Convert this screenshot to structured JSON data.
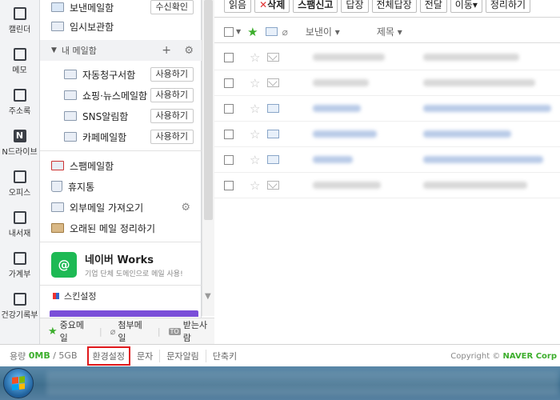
{
  "rail": {
    "items": [
      {
        "label": "캘린더",
        "icon": "calendar-icon"
      },
      {
        "label": "메모",
        "icon": "memo-icon"
      },
      {
        "label": "주소록",
        "icon": "contacts-icon"
      },
      {
        "label": "N드라이브",
        "icon": "ndrive-icon"
      },
      {
        "label": "오피스",
        "icon": "office-icon"
      },
      {
        "label": "내서재",
        "icon": "library-icon"
      },
      {
        "label": "가계부",
        "icon": "ledger-icon"
      },
      {
        "label": "건강기록부",
        "icon": "health-icon"
      }
    ]
  },
  "panel": {
    "sent": {
      "label": "보낸메일함",
      "button": "수신확인"
    },
    "drafts": {
      "label": "임시보관함"
    },
    "my_folders": {
      "label": "내 메일함",
      "add": "+",
      "settings_icon": "gear-icon"
    },
    "folders": [
      {
        "label": "자동청구서함",
        "button": "사용하기",
        "icon": "bill-folder-icon"
      },
      {
        "label": "쇼핑·뉴스메일함",
        "button": "사용하기",
        "icon": "shopping-folder-icon"
      },
      {
        "label": "SNS알림함",
        "button": "사용하기",
        "icon": "sns-folder-icon"
      },
      {
        "label": "카페메일함",
        "button": "사용하기",
        "icon": "cafe-folder-icon"
      }
    ],
    "spam": {
      "label": "스팸메일함"
    },
    "trash": {
      "label": "휴지통"
    },
    "import": {
      "label": "외부메일 가져오기"
    },
    "cleanup": {
      "label": "오래된 메일 정리하기"
    },
    "works": {
      "logo": "@",
      "title": "네이버 Works",
      "subtitle": "기업 단체 도메인으로 메일 사용!"
    },
    "skin": {
      "label": "스킨설정"
    }
  },
  "quick": {
    "important": "중요메일",
    "attach": "첨부메일",
    "to_me": "받는사람",
    "to_me_badge": "TO"
  },
  "toolbar": {
    "buttons": [
      {
        "label": "읽음"
      },
      {
        "label": "삭제",
        "prefix": "✕"
      },
      {
        "label": "스팸신고"
      },
      {
        "label": "답장"
      },
      {
        "label": "전체답장"
      },
      {
        "label": "전달"
      },
      {
        "label": "이동▾"
      },
      {
        "label": "정리하기"
      }
    ]
  },
  "columns": {
    "sender": "보낸이",
    "subject": "제목"
  },
  "mails": [
    {
      "read": true,
      "highlight": false
    },
    {
      "read": true,
      "highlight": false
    },
    {
      "read": false,
      "highlight": true
    },
    {
      "read": false,
      "highlight": true
    },
    {
      "read": false,
      "highlight": true
    },
    {
      "read": true,
      "highlight": false
    }
  ],
  "status": {
    "quota_label": "용량",
    "quota_used": "0MB",
    "quota_total": "/ 5GB",
    "settings": "환경설정",
    "sms": "문자",
    "sms_alert": "문자알림",
    "shortcuts": "단축키",
    "copyright_prefix": "Copyright ©",
    "copyright_brand": "NAVER Corp"
  },
  "colors": {
    "accent_green": "#3cae2c",
    "highlight_red": "#e0181b",
    "skin_purple": "#7a4fd8"
  }
}
